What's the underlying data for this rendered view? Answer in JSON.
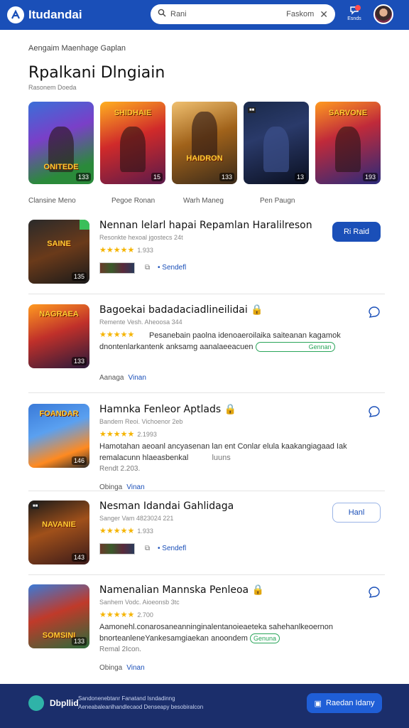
{
  "header": {
    "brand": "Itudandai",
    "search_text": "Rani",
    "search_filter": "Faskom",
    "notif_label": "Esnds"
  },
  "breadcrumb": "Aengaim Maenhage Gaplan",
  "page": {
    "title": "Rpalkani Dlngiain",
    "subtitle": "Rasonem Doeda"
  },
  "carousel": {
    "tiles": [
      {
        "badge": "133",
        "text": "ONITEDE"
      },
      {
        "badge": "15",
        "text": "SHIDHAIE"
      },
      {
        "badge": "133",
        "text": "HAIDRON"
      },
      {
        "badge": "13",
        "text": ""
      },
      {
        "badge": "193",
        "text": "SARVONE"
      }
    ],
    "captions": [
      "Clansine Meno",
      "Pegoe Ronan",
      "Warh Maneg",
      "Pen Paugn"
    ]
  },
  "rows": [
    {
      "title": "Nennan lelarl hapai Repamlan Haralilreson",
      "meta": "Resonkte hexoal jgostecs 24t",
      "rating": "1.933",
      "badge": "135",
      "thumb_text": "SAINE",
      "strip_label": "Sendefl",
      "button": "Ri Raid",
      "button_style": "primary"
    },
    {
      "title": "Bagoekai badadaciadlineilidai",
      "meta": "Remente Vesh. Aheoosa 344",
      "rating": "",
      "badge": "133",
      "thumb_text": "NAGRAEA",
      "desc": "Pesanebain paolna idenoaeroilaika saiteanan kagamok dnontenlarkantenk anksamg aanalaeeacuen",
      "tag": "Gennan",
      "links_gray": "Aanaga",
      "links": "Vinan"
    },
    {
      "title": "Hamnka Fenleor Aptlads",
      "meta": "Bandem Reoi. Vichoenor 2eb",
      "rating": "2.1993",
      "badge": "146",
      "thumb_text": "FOANDAR",
      "desc": "Hamotahan aeoanl ancyasenan lan ent Conlar elula kaakangiagaad Iak remalacunn hlaeasbenkal",
      "desc_end": "luuns",
      "extra": "Rendt 2.203.",
      "links_gray": "Obinga",
      "links": "Vinan"
    },
    {
      "title": "Nesman Idandai Gahlidaga",
      "meta": "Sanger Vam 4823024 221",
      "rating": "1.933",
      "badge": "143",
      "thumb_text": "NAVANIE",
      "strip_label": "Sendefl",
      "button": "Hanl",
      "button_style": "outline"
    },
    {
      "title": "Namenalian Mannska Penleoa",
      "meta": "Sanhem Vodc. Aioeonsb 3tc",
      "rating": "2.700",
      "badge": "133",
      "thumb_text": "SOMSINI",
      "desc": "Aamonehl.conarosaneanninginalentanoieaeteka sahehanlkeoernon bnorteanleneYankesamgiaekan anoondem",
      "tag": "Genuna",
      "extra": "Remal 2Icon.",
      "links_gray": "Obinga",
      "links": "Vinan"
    }
  ],
  "footer": {
    "brand": "Dbpllid",
    "line1": "Sandonenebtanr Fanatand Isndadinng",
    "line2": "Aeneabaleanlhandlecaod Denseapy besobiralcon",
    "button": "Raedan Idany"
  },
  "colors": {
    "primary": "#1a4fb8",
    "footer": "#1b2e6b",
    "star": "#f5b400",
    "tag": "#2aa55a"
  }
}
